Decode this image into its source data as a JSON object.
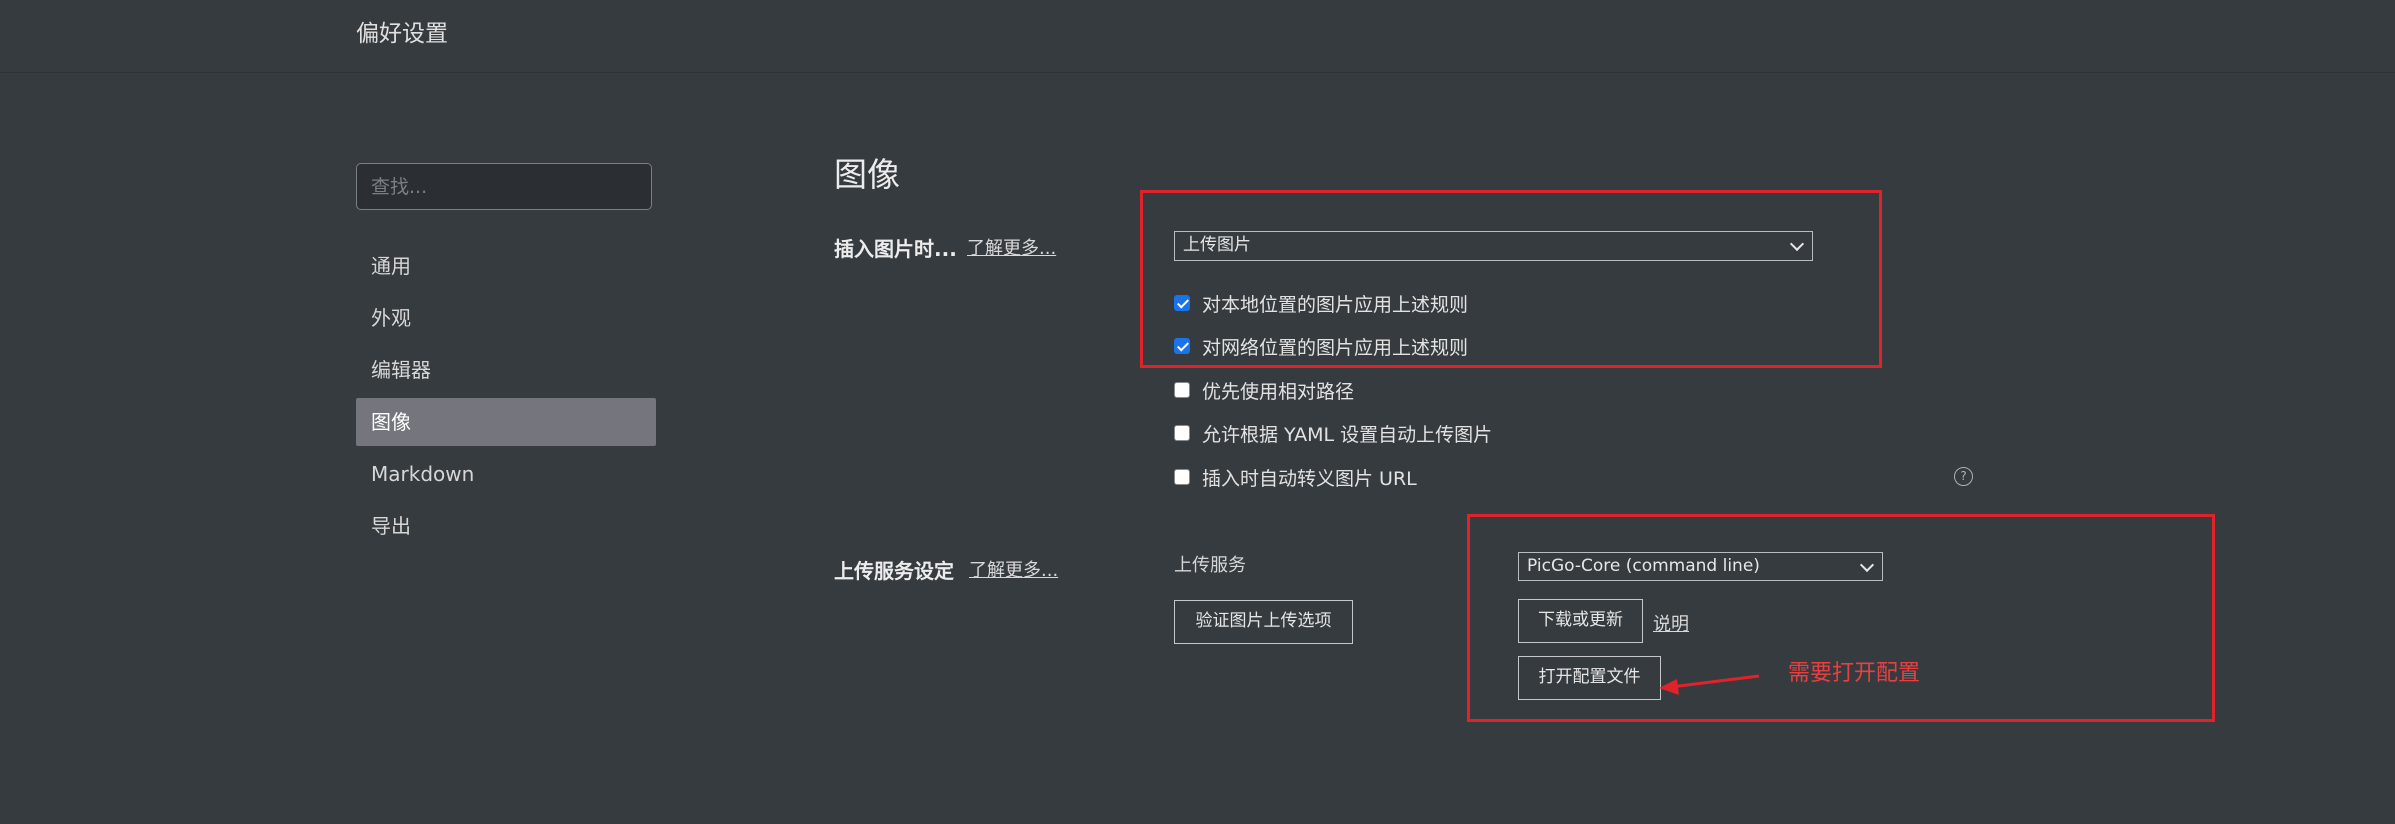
{
  "window": {
    "title": "偏好设置"
  },
  "sidebar": {
    "search_placeholder": "查找...",
    "items": [
      {
        "label": "通用"
      },
      {
        "label": "外观"
      },
      {
        "label": "编辑器"
      },
      {
        "label": "图像",
        "active": true
      },
      {
        "label": "Markdown"
      },
      {
        "label": "导出"
      }
    ]
  },
  "main": {
    "section_title": "图像",
    "insert": {
      "label": "插入图片时...",
      "learn_more": "了解更多...",
      "select_value": "上传图片",
      "options": [
        {
          "label": "对本地位置的图片应用上述规则",
          "checked": true
        },
        {
          "label": "对网络位置的图片应用上述规则",
          "checked": true
        },
        {
          "label": "优先使用相对路径",
          "checked": false
        },
        {
          "label": "允许根据 YAML 设置自动上传图片",
          "checked": false
        },
        {
          "label": "插入时自动转义图片 URL",
          "checked": false
        }
      ],
      "help_icon": "?"
    },
    "upload": {
      "label": "上传服务设定",
      "learn_more": "了解更多...",
      "service_label": "上传服务",
      "service_value": "PicGo-Core (command line)",
      "verify_button": "验证图片上传选项",
      "download_button": "下载或更新",
      "explain_link": "说明",
      "open_config_button": "打开配置文件"
    }
  },
  "annotation": {
    "text": "需要打开配置",
    "color": "#e0222b"
  }
}
